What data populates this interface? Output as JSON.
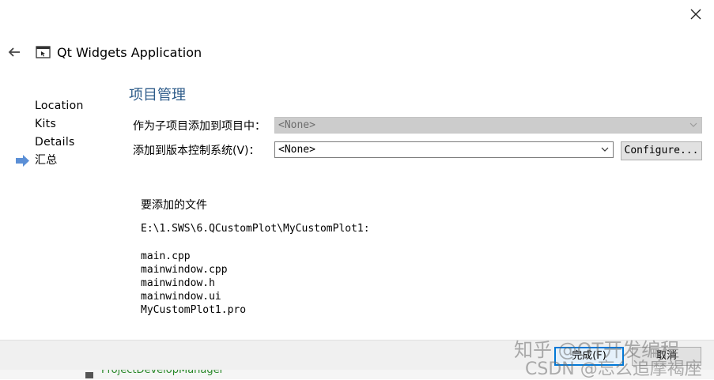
{
  "window": {
    "close_icon": "close-icon"
  },
  "header": {
    "back_icon": "arrow-left-icon",
    "app_icon": "qt-app-icon",
    "title": "Qt Widgets Application"
  },
  "steps": [
    {
      "label": "Location",
      "current": false
    },
    {
      "label": "Kits",
      "current": false
    },
    {
      "label": "Details",
      "current": false
    },
    {
      "label": "汇总",
      "current": true
    }
  ],
  "page": {
    "title": "项目管理",
    "subproject": {
      "label": "作为子项目添加到项目中：",
      "value": "<None>",
      "enabled": false
    },
    "vcs": {
      "label": "添加到版本控制系统(V)：",
      "value": "<None>",
      "enabled": true
    },
    "configure_label": "Configure..."
  },
  "summary": {
    "heading": "要添加的文件",
    "path": "E:\\1.SWS\\6.QCustomPlot\\MyCustomPlot1:",
    "files": [
      "main.cpp",
      "mainwindow.cpp",
      "mainwindow.h",
      "mainwindow.ui",
      "MyCustomPlot1.pro"
    ]
  },
  "footer": {
    "finish_label": "完成(F)",
    "cancel_label": "取消"
  },
  "background_ide": {
    "text": "ProjectDevelopManager"
  },
  "watermark": {
    "line1": "知乎 @QT开发编程",
    "line2": "CSDN @忘么追摩褐座"
  },
  "colors": {
    "accent": "#0078d7",
    "page_title": "#2e5c8a",
    "disabled_field": "#cccccc",
    "bottom_bar": "#f0f0f0"
  }
}
